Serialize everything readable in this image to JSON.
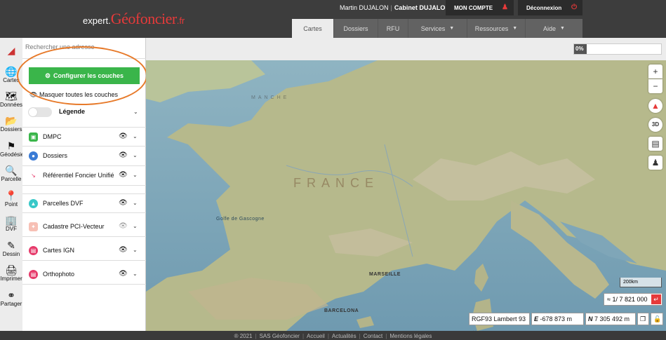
{
  "header": {
    "logo_prefix": "expert.",
    "logo_main": "Géofoncier",
    "logo_suffix": ".fr",
    "user_name": "Martin DUJALON",
    "cabinet": "Cabinet DUJALON",
    "account_button": "MON COMPTE",
    "logout_button": "Déconnexion",
    "tabs": [
      {
        "label": "Cartes",
        "active": true
      },
      {
        "label": "Dossiers"
      },
      {
        "label": "RFU"
      },
      {
        "label": "Services"
      },
      {
        "label": "Ressources"
      },
      {
        "label": "Aide"
      }
    ]
  },
  "sidebar": {
    "items": [
      {
        "label": "Cartes",
        "icon": "globe-icon"
      },
      {
        "label": "Données",
        "icon": "map-icon"
      },
      {
        "label": "Dossiers",
        "icon": "folder-icon"
      },
      {
        "label": "Géodésie",
        "icon": "flag-icon"
      },
      {
        "label": "Parcelle",
        "icon": "search-icon"
      },
      {
        "label": "Point",
        "icon": "pin-icon"
      },
      {
        "label": "DVF",
        "icon": "building-icon"
      },
      {
        "label": "Dessin",
        "icon": "pencil-icon"
      },
      {
        "label": "Imprimer",
        "icon": "print-icon"
      },
      {
        "label": "Partager",
        "icon": "share-icon"
      }
    ]
  },
  "panel": {
    "search_placeholder": "Rechercher une adresse",
    "config_button": "Configurer les couches",
    "hide_all": "Masquer toutes les couches",
    "legend_label": "Légende",
    "layers": [
      {
        "name": "DMPC",
        "icon_color": "#3ab54a",
        "visible": true
      },
      {
        "name": "Dossiers",
        "icon_color": "#3a7bd5",
        "visible": true
      },
      {
        "name": "Référentiel Foncier Unifié",
        "icon_color": "#e63a6a",
        "visible": true
      },
      {
        "name": "Parcelles DVF",
        "icon_color": "#38c8c8",
        "visible": true
      },
      {
        "name": "Cadastre PCI-Vecteur",
        "icon_color": "#f09a8a",
        "visible": false
      },
      {
        "name": "Cartes IGN",
        "icon_color": "#e63a6a",
        "visible": true
      },
      {
        "name": "Orthophoto",
        "icon_color": "#e63a6a",
        "visible": true
      }
    ]
  },
  "map": {
    "progress_label": "0%",
    "progress_value": 0,
    "scale_bar": "200km",
    "scale_value": "≈ 1/ 7 821 000",
    "projection": "RGF93 Lambert 93",
    "easting_label": "E",
    "easting": "-678 873 m",
    "northing_label": "N",
    "northing": "7 305 492 m",
    "labels": {
      "manche": "MANCHE",
      "gascogne": "Golfe de Gascogne",
      "france": "FRANCE",
      "marseille": "MARSEILLE",
      "barcelona": "BARCELONA"
    }
  },
  "footer": {
    "copyright": "® 2021",
    "links": [
      "SAS Géofoncier",
      "Accueil",
      "Actualités",
      "Contact",
      "Mentions légales"
    ]
  }
}
